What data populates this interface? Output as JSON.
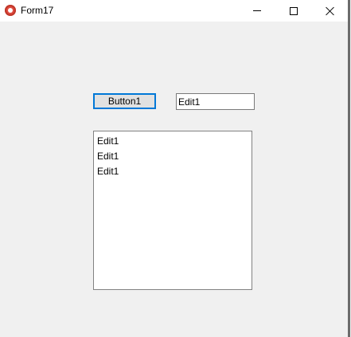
{
  "window": {
    "title": "Form17",
    "app_icon": "delphi-app-icon",
    "controls": {
      "minimize_icon": "minimize-icon",
      "maximize_icon": "maximize-icon",
      "close_icon": "close-icon"
    }
  },
  "form": {
    "button1_label": "Button1",
    "edit1_value": "Edit1",
    "memo_lines": [
      "Edit1",
      "Edit1",
      "Edit1"
    ]
  },
  "colors": {
    "form_background": "#f0f0f0",
    "button_focus_border": "#0078d7",
    "titlebar_background": "#ffffff"
  }
}
